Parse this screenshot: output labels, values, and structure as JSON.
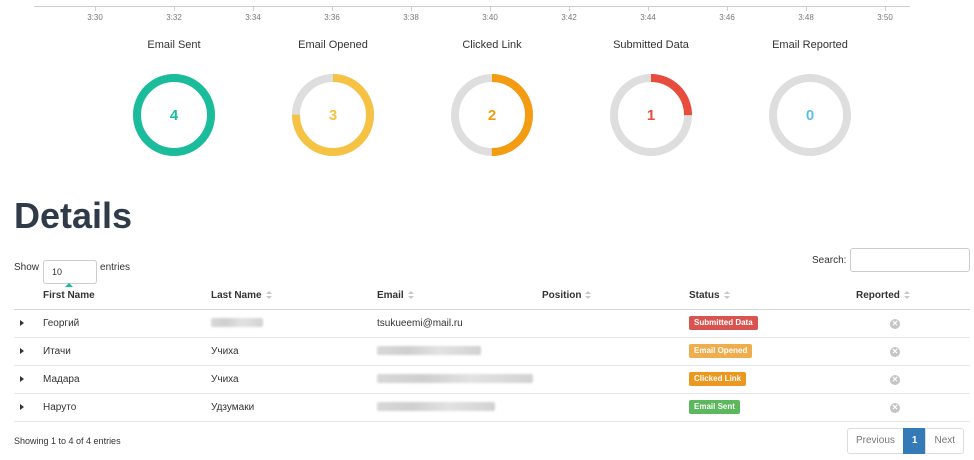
{
  "timeline": {
    "ticks": [
      "3:30",
      "3:32",
      "3:34",
      "3:36",
      "3:38",
      "3:40",
      "3:42",
      "3:44",
      "3:46",
      "3:48",
      "3:50"
    ]
  },
  "stats": [
    {
      "title": "Email Sent",
      "value": "4",
      "fraction": 1.0,
      "color": "#1abc9c"
    },
    {
      "title": "Email Opened",
      "value": "3",
      "fraction": 0.75,
      "color": "#f6c244"
    },
    {
      "title": "Clicked Link",
      "value": "2",
      "fraction": 0.5,
      "color": "#f39c12"
    },
    {
      "title": "Submitted Data",
      "value": "1",
      "fraction": 0.25,
      "color": "#e74c3c"
    },
    {
      "title": "Email Reported",
      "value": "0",
      "fraction": 0.0,
      "color": "#5bc0de"
    }
  ],
  "details": {
    "title": "Details",
    "show_label": "Show",
    "entries_value": "10",
    "entries_label": "entries",
    "search_label": "Search:",
    "search_value": ""
  },
  "table": {
    "columns": [
      "First Name",
      "Last Name",
      "Email",
      "Position",
      "Status",
      "Reported"
    ],
    "rows": [
      {
        "first_name": "Георгий",
        "last_name": "",
        "email": "tsukueemi@mail.ru",
        "position": "",
        "status": "Submitted Data",
        "status_color": "#d9534f"
      },
      {
        "first_name": "Итачи",
        "last_name": "Учиха",
        "email": "",
        "position": "",
        "status": "Email Opened",
        "status_color": "#f0ad4e"
      },
      {
        "first_name": "Мадара",
        "last_name": "Учиха",
        "email": "",
        "position": "",
        "status": "Clicked Link",
        "status_color": "#ec971f"
      },
      {
        "first_name": "Наруто",
        "last_name": "Удзумаки",
        "email": "",
        "position": "",
        "status": "Email Sent",
        "status_color": "#5cb85c"
      }
    ]
  },
  "footer": {
    "info": "Showing 1 to 4 of 4 entries",
    "previous": "Previous",
    "page": "1",
    "next": "Next"
  }
}
